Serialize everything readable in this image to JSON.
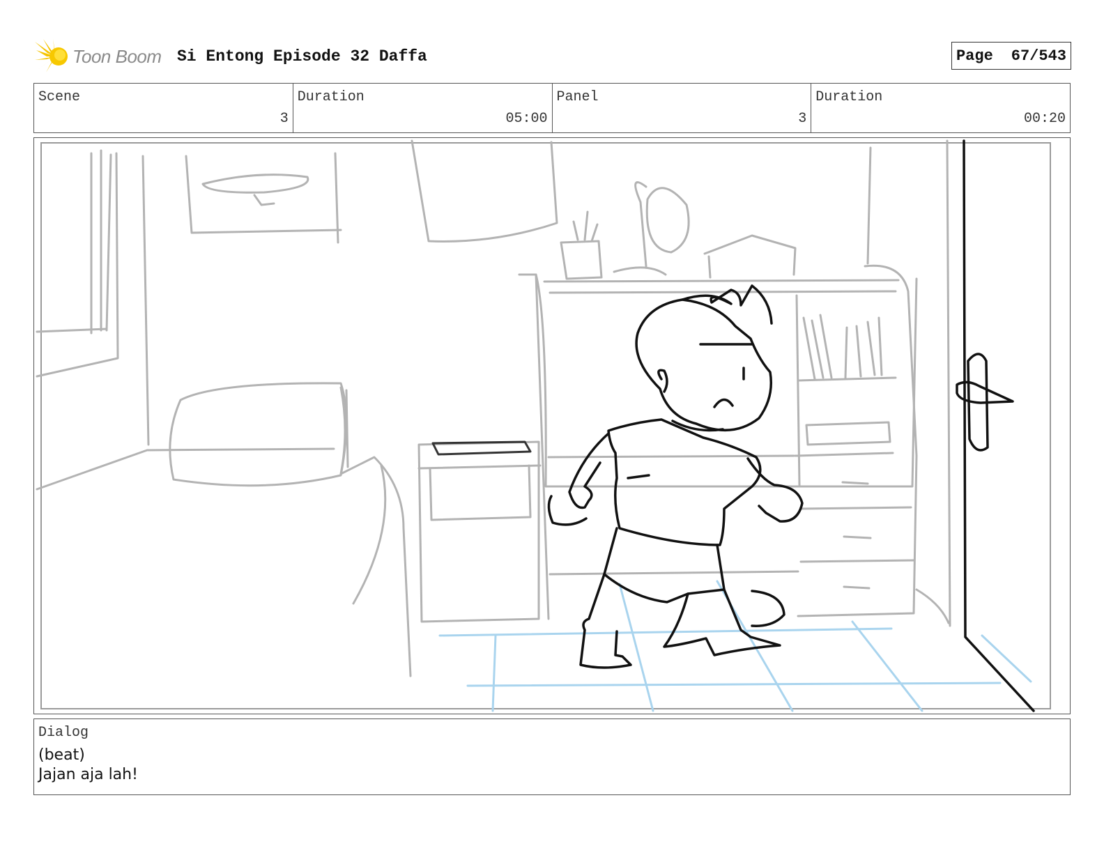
{
  "header": {
    "logo_text": "Toon Boom",
    "project_title": "Si Entong Episode 32 Daffa",
    "page_label": "Page",
    "page_value": "67/543"
  },
  "info": {
    "scene_label": "Scene",
    "scene_value": "3",
    "scene_duration_label": "Duration",
    "scene_duration_value": "05:00",
    "panel_label": "Panel",
    "panel_value": "3",
    "panel_duration_label": "Duration",
    "panel_duration_value": "00:20"
  },
  "dialog": {
    "label": "Dialog",
    "lines": [
      "(beat)",
      "Jajan aja lah!"
    ]
  },
  "colors": {
    "logo_yellow": "#f5c400",
    "sketch_grey": "#b0b0b0",
    "sketch_black": "#111111",
    "floor_blue": "#a9d4ee"
  }
}
